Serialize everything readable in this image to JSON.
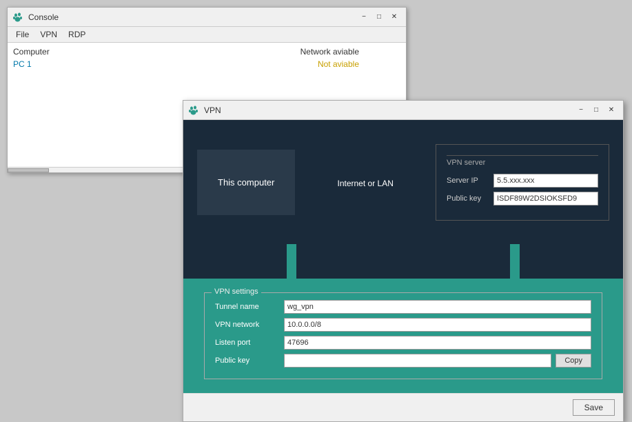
{
  "console_window": {
    "title": "Console",
    "menu": {
      "file": "File",
      "vpn": "VPN",
      "rdp": "RDP"
    },
    "table": {
      "header_computer": "Computer",
      "header_network": "Network aviable",
      "row": {
        "name": "PC 1",
        "status": "Not aviable"
      }
    }
  },
  "vpn_window": {
    "title": "VPN",
    "diagram": {
      "this_computer": "This computer",
      "internet_label": "Internet or LAN"
    },
    "vpn_server": {
      "legend": "VPN server",
      "server_ip_label": "Server IP",
      "server_ip_value": "5.5.xxx.xxx",
      "public_key_label": "Public key",
      "public_key_value": "ISDF89W2DSIOKSFD9"
    },
    "vpn_settings": {
      "legend": "VPN settings",
      "tunnel_name_label": "Tunnel name",
      "tunnel_name_value": "wg_vpn",
      "vpn_network_label": "VPN network",
      "vpn_network_value": "10.0.0.0/8",
      "listen_port_label": "Listen port",
      "listen_port_value": "47696",
      "public_key_label": "Public key",
      "public_key_value": "",
      "copy_button": "Copy"
    },
    "save_button": "Save"
  },
  "titlebar_controls": {
    "minimize": "−",
    "maximize": "□",
    "close": "✕"
  }
}
